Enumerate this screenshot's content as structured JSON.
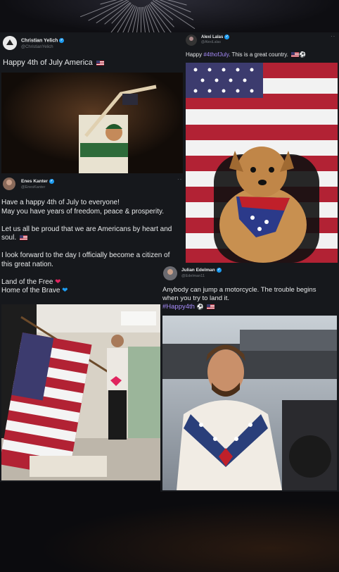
{
  "tweets": [
    {
      "name": "Christian Yelich",
      "handle": "@ChristianYelich",
      "text": "Happy 4th of July America",
      "flag": "🇺🇸"
    },
    {
      "name": "Alexi Lalas",
      "handle": "@AlexiLalas",
      "text_before": "Happy ",
      "hashtag": "#4thofJuly",
      "text_after": ". This is a great country.",
      "flag": "🇺🇸",
      "ball": "⚽"
    },
    {
      "name": "Enes Kanter",
      "handle": "@EnesKanter",
      "lines": [
        "Have a happy 4th of July to everyone!",
        "May you have years of freedom, peace & prosperity.",
        "",
        "Let us all be proud that we are Americans by heart and",
        "soul.",
        "",
        "I look forward to the day I officially become a citizen of",
        "this great nation.",
        "",
        "Land of the Free",
        "Home of the Brave"
      ]
    },
    {
      "name": "Julian Edelman",
      "handle": "@Edelman11",
      "line1": "Anybody can jump a motorcycle. The trouble begins",
      "line2": "when you try to land it.",
      "hashtag": "#Happy4th"
    }
  ],
  "icons": {
    "more": "more-options-icon",
    "verified": "verified-badge-icon"
  },
  "colors": {
    "card_bg": "#16181c",
    "page_bg": "#0b0b0e",
    "hashtag": "#a78bfa",
    "verified": "#1d9bf0"
  }
}
